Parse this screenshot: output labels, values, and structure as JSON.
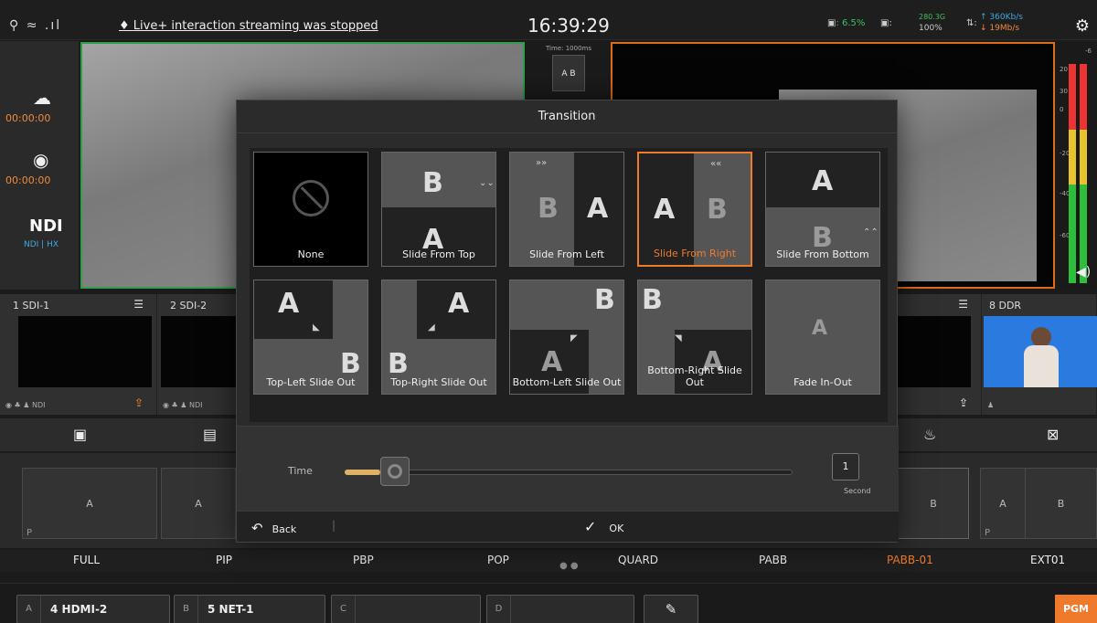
{
  "topbar": {
    "signal": "⚲ ≈ .ıl",
    "notice": "Live+ interaction streaming was stopped",
    "clock": "16:39:29",
    "cpu": "6.5%",
    "disk_used": "280.3G",
    "disk_pct": "100%",
    "up_rate": "360Kb/s",
    "down_rate": "19Mb/s"
  },
  "left": {
    "stream_time": "00:00:00",
    "record_time": "00:00:00",
    "ndi": "NDI",
    "ndi_hx": "NDI | HX"
  },
  "mid": {
    "time_label": "Time: 1000ms",
    "ab": "A B"
  },
  "meter": {
    "labels": [
      "-6",
      "20",
      "30",
      "0",
      "-20",
      "-40",
      "-60"
    ]
  },
  "sources": [
    {
      "label": "1 SDI-1"
    },
    {
      "label": "2 SDI-2"
    },
    {
      "label": "8 DDR"
    }
  ],
  "layouts": [
    "FULL",
    "PIP",
    "PBP",
    "POP",
    "QUARD",
    "PABB",
    "PABB-01",
    "EXT01"
  ],
  "layout_cells": {
    "a": "A",
    "b": "B",
    "p": "P"
  },
  "bottom": [
    {
      "key": "A",
      "value": "4 HDMI-2"
    },
    {
      "key": "B",
      "value": "5 NET-1"
    },
    {
      "key": "C",
      "value": ""
    },
    {
      "key": "D",
      "value": ""
    }
  ],
  "pgm": "PGM",
  "modal": {
    "title": "Transition",
    "transitions": [
      "None",
      "Slide From Top",
      "Slide From Left",
      "Slide From Right",
      "Slide From Bottom",
      "Top-Left Slide Out",
      "Top-Right Slide Out",
      "Bottom-Left Slide Out",
      "Bottom-Right Slide Out",
      "Fade In-Out"
    ],
    "selected": "Slide From Right",
    "time_label": "Time",
    "time_value": "1",
    "time_unit": "Second",
    "slider_fraction": 0.08,
    "back": "Back",
    "ok": "OK"
  },
  "colors": {
    "accent": "#f07a2c",
    "preview": "#2fa04a",
    "program": "#e06a1a",
    "slider": "#e0b064"
  }
}
